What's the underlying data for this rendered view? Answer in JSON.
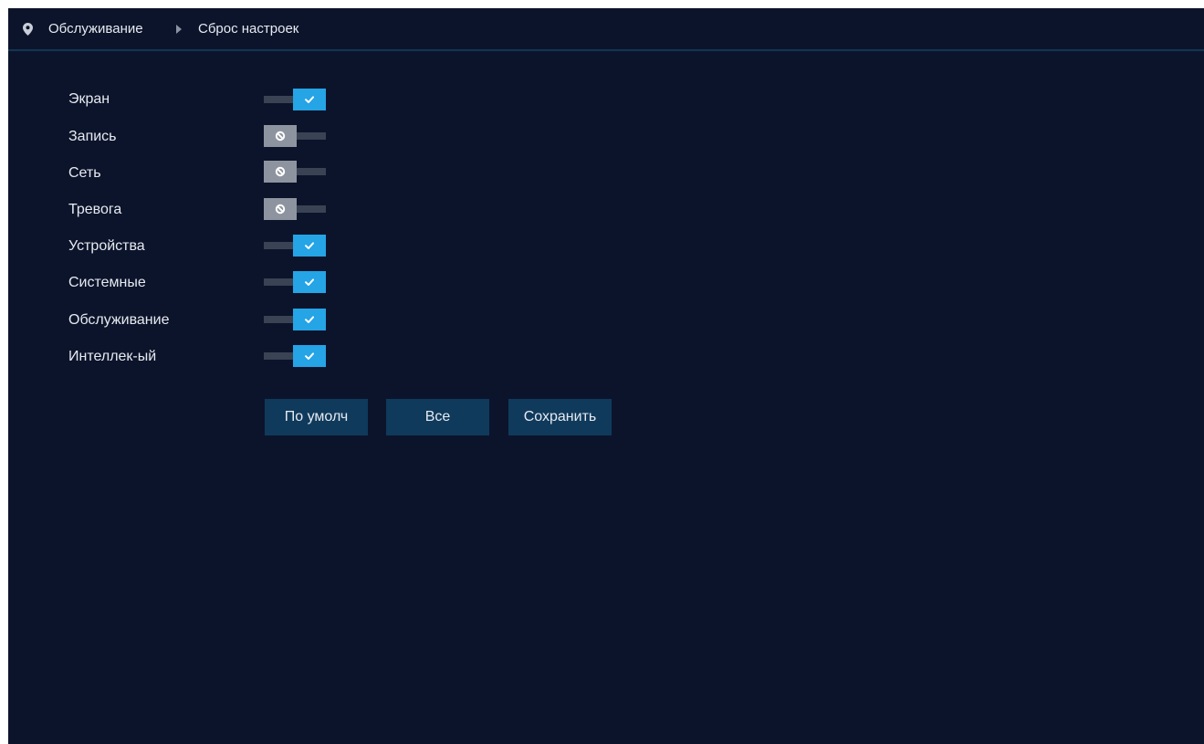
{
  "breadcrumb": {
    "icon": "location-pin-icon",
    "section": "Обслуживание",
    "separator_icon": "triangle-right-icon",
    "page": "Сброс настроек"
  },
  "options": [
    {
      "label": "Экран",
      "enabled": true
    },
    {
      "label": "Запись",
      "enabled": false
    },
    {
      "label": "Сеть",
      "enabled": false
    },
    {
      "label": "Тревога",
      "enabled": false
    },
    {
      "label": "Устройства",
      "enabled": true
    },
    {
      "label": "Системные",
      "enabled": true
    },
    {
      "label": "Обслуживание",
      "enabled": true
    },
    {
      "label": "Интеллек-ый",
      "enabled": true
    }
  ],
  "buttons": {
    "default_label": "По умолч",
    "all_label": "Все",
    "save_label": "Сохранить"
  },
  "colors": {
    "background": "#0c142b",
    "accent": "#25a4e6",
    "toggle_off": "#8e949f",
    "button": "#103a5c"
  }
}
